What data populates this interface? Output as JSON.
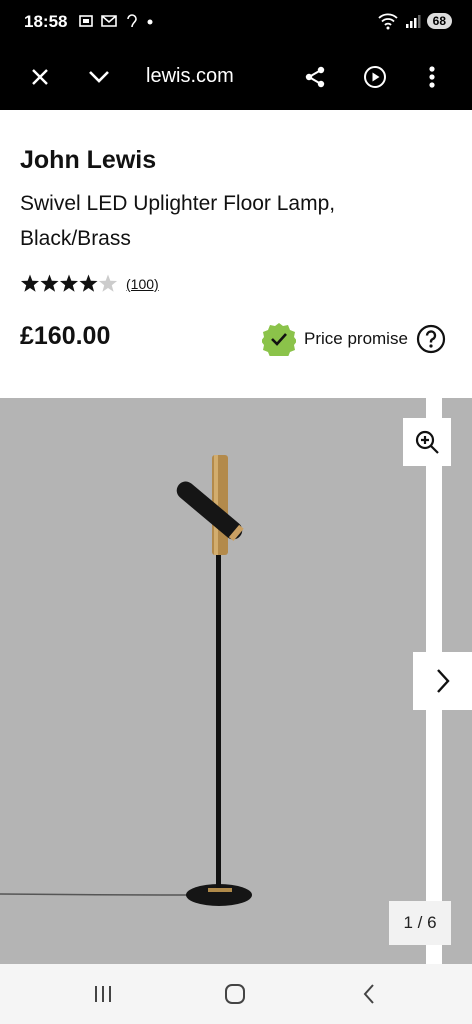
{
  "status_bar": {
    "time": "18:58",
    "battery": "68"
  },
  "browser": {
    "url": "lewis.com"
  },
  "product": {
    "brand": "John Lewis",
    "title": "Swivel LED Uplighter Floor Lamp, Black/Brass",
    "rating_stars": 4,
    "review_count": "(100)",
    "price": "£160.00",
    "price_promise_label": "Price promise"
  },
  "gallery": {
    "counter": "1 / 6"
  },
  "colors": {
    "accent_check": "#8bc34a",
    "gallery_bg": "#b4b4b4"
  }
}
